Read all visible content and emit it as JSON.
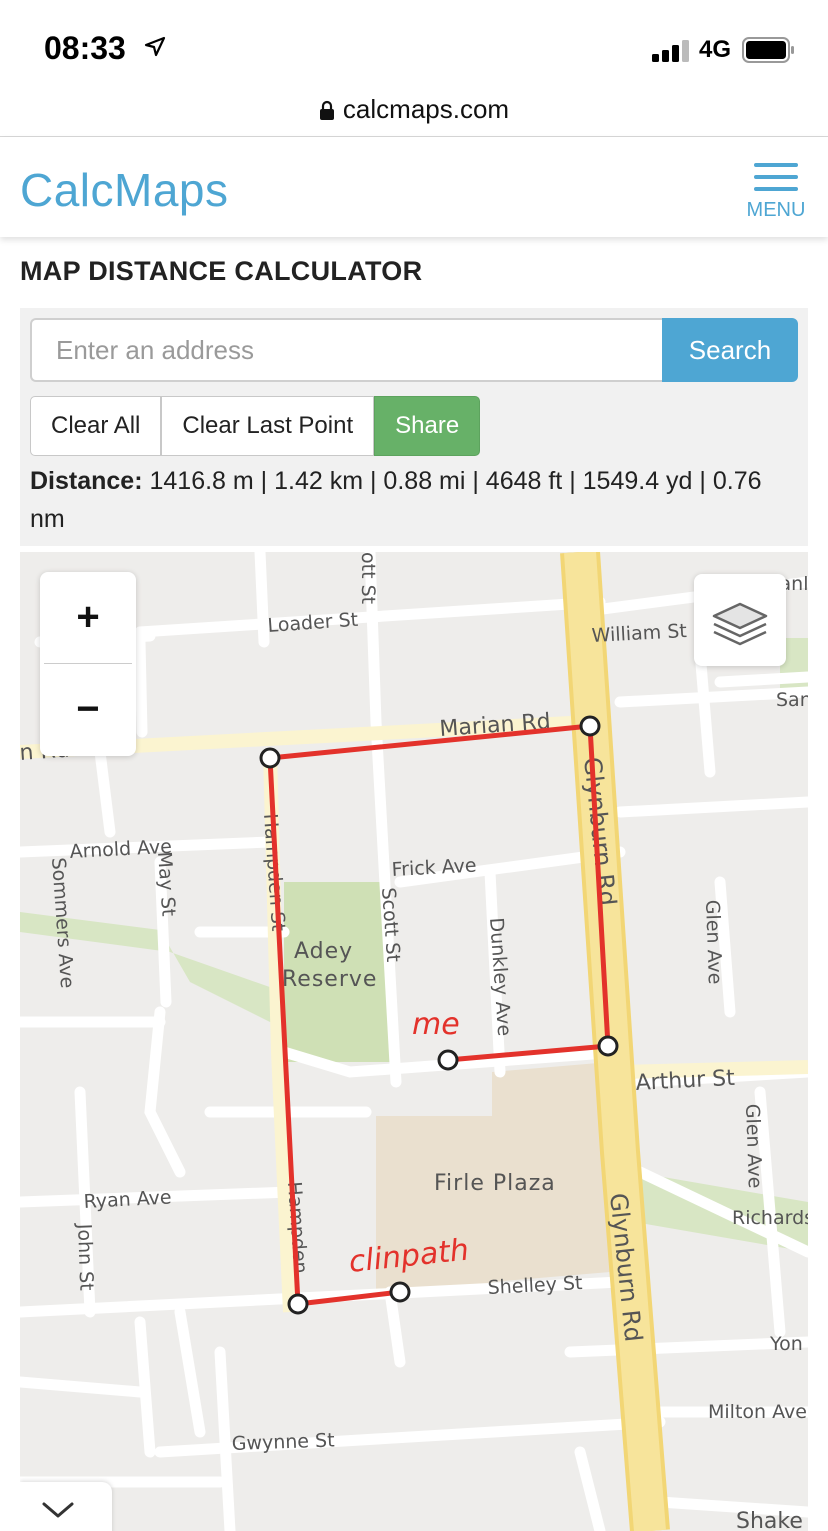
{
  "status_bar": {
    "time": "08:33",
    "carrier": "4G"
  },
  "browser": {
    "url": "calcmaps.com"
  },
  "site": {
    "logo": "CalcMaps",
    "menu_label": "MENU"
  },
  "page": {
    "title": "MAP DISTANCE CALCULATOR"
  },
  "search": {
    "placeholder": "Enter an address",
    "value": "",
    "button_label": "Search"
  },
  "toolbar": {
    "clear_all": "Clear All",
    "clear_last": "Clear Last Point",
    "share": "Share"
  },
  "distance": {
    "label": "Distance:",
    "value": "1416.8 m | 1.42 km | 0.88 mi | 4648 ft | 1549.4 yd | 0.76 nm"
  },
  "map": {
    "zoom_in": "+",
    "zoom_out": "−",
    "streets": {
      "loader": "Loader St",
      "william": "William St",
      "marian": "Marian Rd",
      "marian_left": "n Rd",
      "arnold": "Arnold Ave",
      "frick": "Frick Ave",
      "arthur": "Arthur St",
      "ryan": "Ryan Ave",
      "shelley": "Shelley St",
      "gwynne": "Gwynne St",
      "milton": "Milton Ave",
      "yon": "Yon",
      "richards": "Richards",
      "shake": "Shake",
      "stanl": "Stanl",
      "san": "San",
      "glynburn_upper": "Glynburn Rd",
      "glynburn_lower": "Glynburn Rd",
      "hampden_upper": "Hampden St",
      "hampden_lower": "Hampden",
      "scott": "Scott St",
      "scott_top": "ott St",
      "may": "May St",
      "sommers": "Sommers Ave",
      "dunkley": "Dunkley Ave",
      "glen_upper": "Glen Ave",
      "glen_lower": "Glen Ave",
      "john": "John St"
    },
    "places": {
      "adey_1": "Adey",
      "adey_2": "Reserve",
      "firle": "Firle Plaza"
    },
    "annotations": {
      "me": "me",
      "clinpath": "clinpath"
    },
    "route_color": "#e3322b",
    "route_points_count": 6
  },
  "colors": {
    "brand": "#4ea6d3",
    "share": "#67b168",
    "major_road": "#f7e49b",
    "park": "#cfe0b5",
    "plaza": "#eae0cf"
  },
  "icons": [
    "location-arrow-icon",
    "signal-icon",
    "battery-icon",
    "lock-icon",
    "hamburger-icon",
    "layers-icon",
    "chevron-down-icon"
  ]
}
